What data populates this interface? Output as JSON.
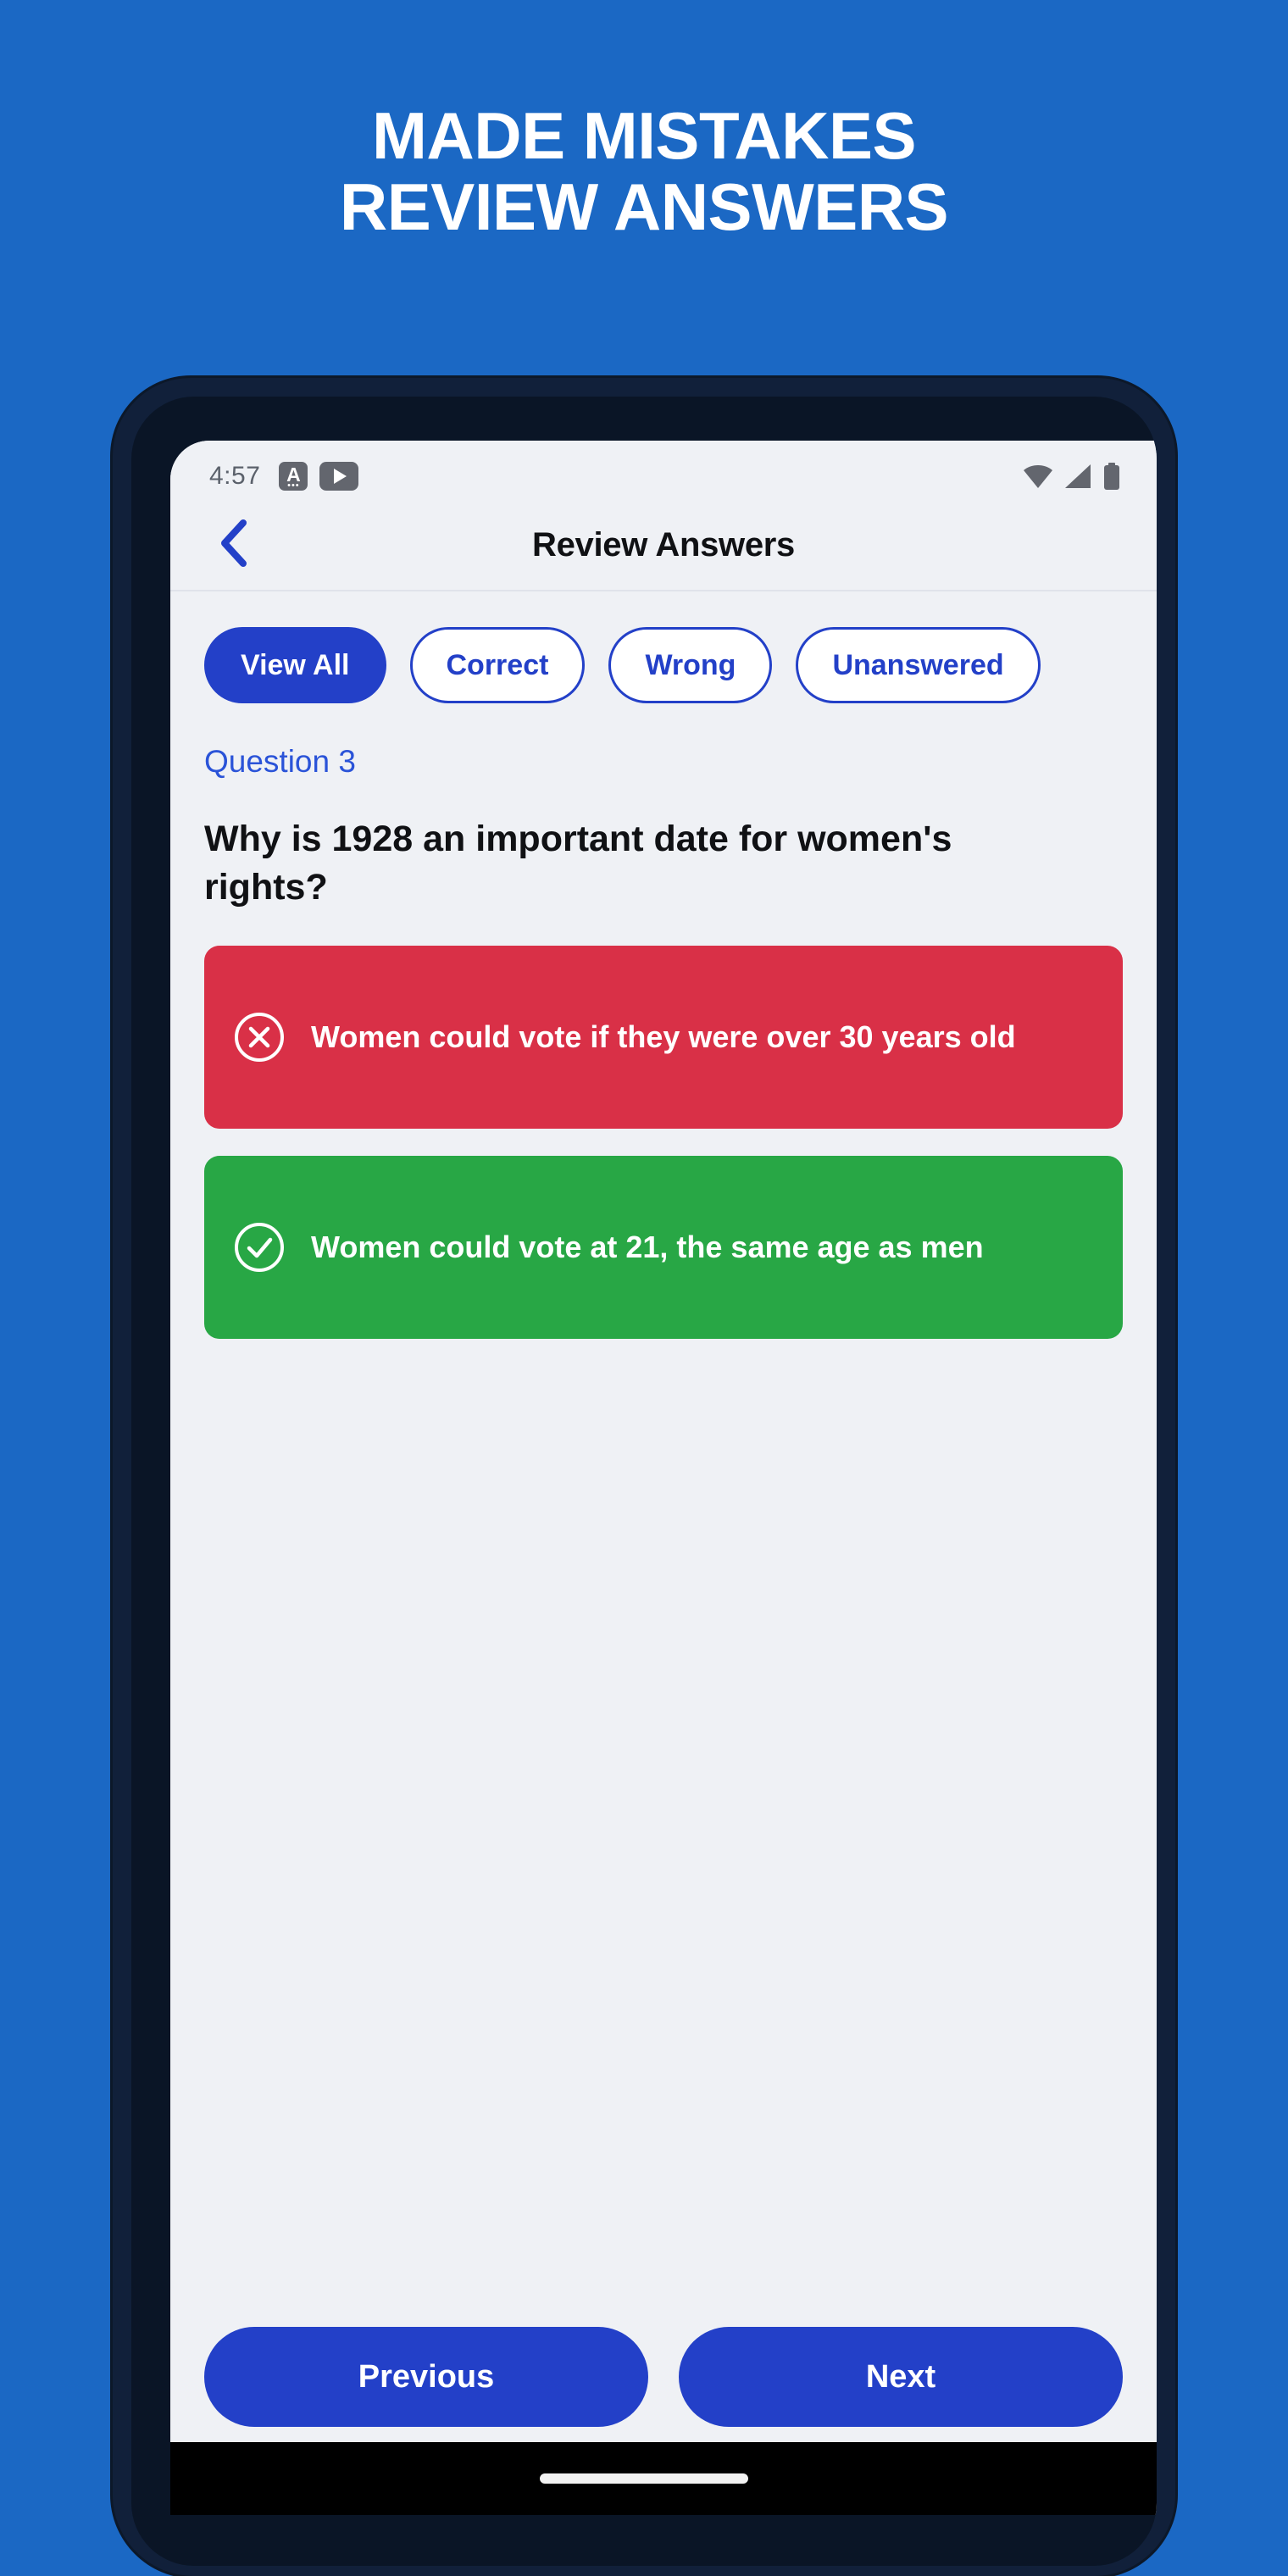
{
  "promo": {
    "line1": "MADE MISTAKES",
    "line2": "REVIEW ANSWERS"
  },
  "colors": {
    "page_background": "#1b68c4",
    "accent_blue": "#2340c8",
    "link_blue": "#2a53d8",
    "wrong_red": "#d93047",
    "correct_green": "#28a745",
    "screen_background": "#eff1f5",
    "phone_frame": "#11203a"
  },
  "status_bar": {
    "time": "4:57",
    "left_icons": [
      "text-badge-icon",
      "video-play-icon"
    ],
    "right_icons": [
      "wifi-icon",
      "cellular-signal-icon",
      "battery-icon"
    ]
  },
  "header": {
    "back_icon": "chevron-left-icon",
    "title": "Review Answers"
  },
  "filters": {
    "chips": [
      {
        "label": "View All",
        "active": true
      },
      {
        "label": "Correct",
        "active": false
      },
      {
        "label": "Wrong",
        "active": false
      },
      {
        "label": "Unanswered",
        "active": false
      }
    ]
  },
  "question": {
    "number_label": "Question 3",
    "text": "Why is 1928 an important date for women's rights?"
  },
  "answers": [
    {
      "text": "Women could vote if they were over 30 years old",
      "state": "wrong",
      "icon": "circle-x-icon"
    },
    {
      "text": "Women could vote at 21, the same age as men",
      "state": "correct",
      "icon": "circle-check-icon"
    }
  ],
  "bottom_nav": {
    "previous_label": "Previous",
    "next_label": "Next"
  }
}
